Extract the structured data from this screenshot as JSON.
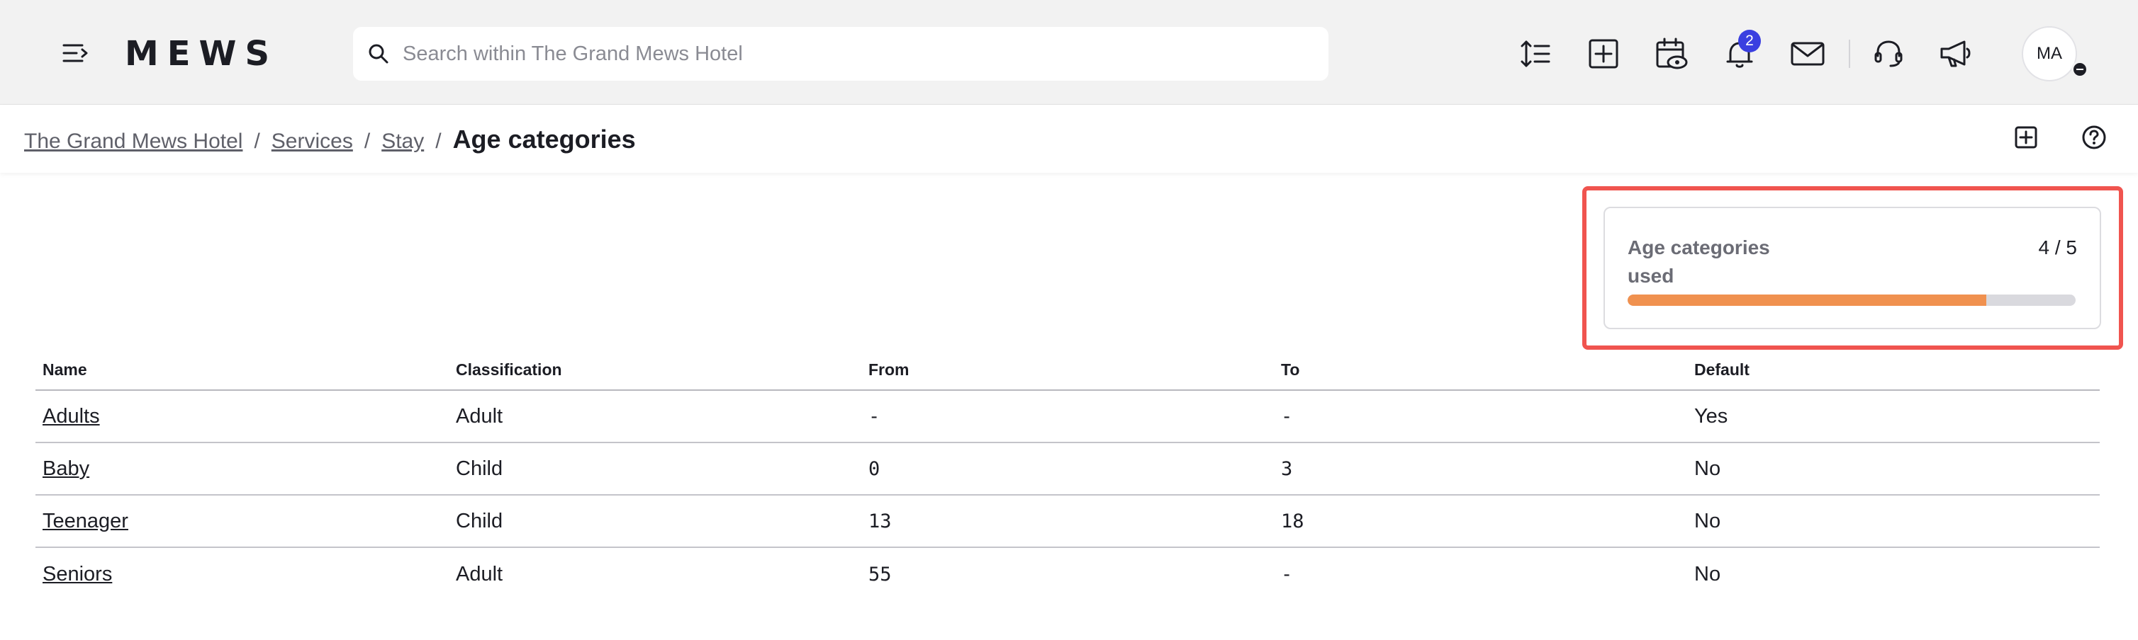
{
  "header": {
    "logo_text": "MEWS",
    "search_placeholder": "Search within The Grand Mews Hotel",
    "notifications_count": "2",
    "avatar_initials": "MA",
    "icons": [
      "menu-icon",
      "search-icon",
      "line-height-icon",
      "add-icon",
      "calendar-eye-icon",
      "bell-icon",
      "mail-icon",
      "headset-icon",
      "megaphone-icon"
    ]
  },
  "breadcrumb": {
    "items": [
      "The Grand Mews Hotel",
      "Services",
      "Stay"
    ],
    "separator": "/",
    "current": "Age categories",
    "icons": [
      "add-icon",
      "help-icon"
    ]
  },
  "usage": {
    "label": "Age categories used",
    "count_text": "4 / 5",
    "used": 4,
    "limit": 5,
    "fill_color": "#f0914f",
    "highlight_color": "#f0544f"
  },
  "table": {
    "headers": [
      "Name",
      "Classification",
      "From",
      "To",
      "Default"
    ],
    "rows": [
      {
        "name": "Adults",
        "classification": "Adult",
        "from": "-",
        "to": "-",
        "default": "Yes"
      },
      {
        "name": "Baby",
        "classification": "Child",
        "from": "0",
        "to": "3",
        "default": "No"
      },
      {
        "name": "Teenager",
        "classification": "Child",
        "from": "13",
        "to": "18",
        "default": "No"
      },
      {
        "name": "Seniors",
        "classification": "Adult",
        "from": "55",
        "to": "-",
        "default": "No"
      }
    ]
  }
}
